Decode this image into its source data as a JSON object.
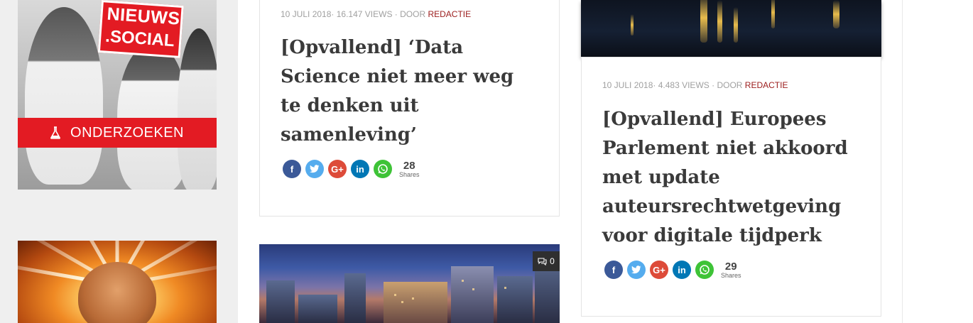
{
  "sidebar": {
    "ad_top": {
      "logo_line1": "NIEUWS",
      "logo_line2": ".SOCIAL",
      "banner_label": "ONDERZOEKEN"
    }
  },
  "articles": [
    {
      "date": "10 JULI 2018",
      "views": "16.147 VIEWS",
      "by": "DOOR",
      "author": "REDACTIE",
      "title_lines": [
        "[Opvallend] ‘Data",
        "Science niet meer weg",
        "te denken uit",
        "samenleving’"
      ],
      "share_count": "28",
      "share_label": "Shares"
    },
    {
      "date": "10 JULI 2018",
      "views": "4.483 VIEWS",
      "by": "DOOR",
      "author": "REDACTIE",
      "title_lines": [
        "[Opvallend] Europees",
        "Parlement niet akkoord",
        "met update",
        "auteursrechtwetgeving",
        "voor digitale tijdperk"
      ],
      "share_count": "29",
      "share_label": "Shares"
    }
  ],
  "image_card": {
    "comment_count": "0"
  },
  "share_icons": [
    "facebook-icon",
    "twitter-icon",
    "google-plus-icon",
    "linkedin-icon",
    "whatsapp-icon"
  ],
  "colors": {
    "author": "#9b1b1b",
    "brand_red": "#e31b23",
    "facebook": "#3b5998",
    "twitter": "#55acee",
    "google_plus": "#dd4b39",
    "linkedin": "#0077b5",
    "whatsapp": "#3ec337"
  }
}
